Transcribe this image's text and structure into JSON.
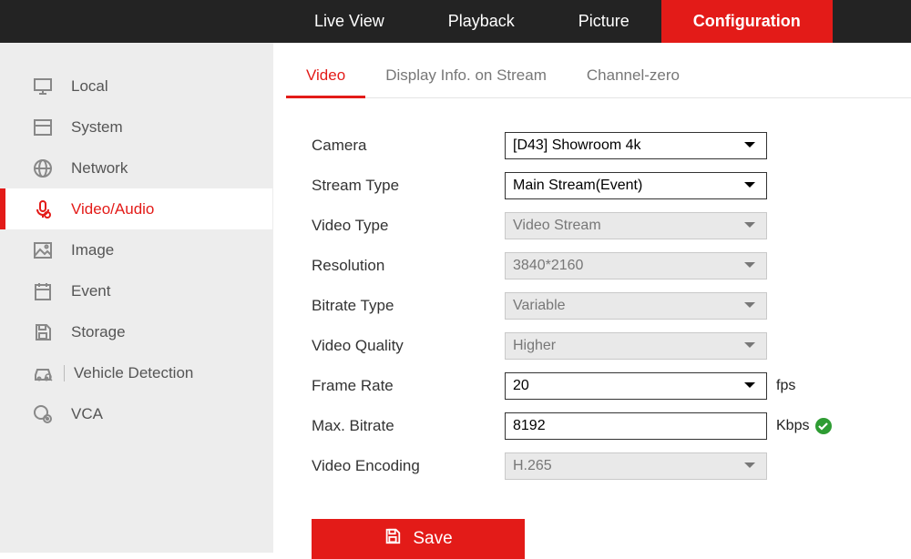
{
  "topnav": {
    "items": [
      "Live View",
      "Playback",
      "Picture",
      "Configuration"
    ],
    "active_index": 3
  },
  "sidebar": {
    "items": [
      {
        "label": "Local",
        "icon": "monitor"
      },
      {
        "label": "System",
        "icon": "window"
      },
      {
        "label": "Network",
        "icon": "globe"
      },
      {
        "label": "Video/Audio",
        "icon": "mic"
      },
      {
        "label": "Image",
        "icon": "image"
      },
      {
        "label": "Event",
        "icon": "calendar"
      },
      {
        "label": "Storage",
        "icon": "disk"
      },
      {
        "label": "Vehicle Detection",
        "icon": "car",
        "divider": true
      },
      {
        "label": "VCA",
        "icon": "vca"
      }
    ],
    "active_index": 3
  },
  "tabs": {
    "items": [
      "Video",
      "Display Info. on Stream",
      "Channel-zero"
    ],
    "active_index": 0
  },
  "form": {
    "camera": {
      "label": "Camera",
      "value": "[D43] Showroom 4k",
      "disabled": false
    },
    "stream_type": {
      "label": "Stream Type",
      "value": "Main Stream(Event)",
      "disabled": false
    },
    "video_type": {
      "label": "Video Type",
      "value": "Video Stream",
      "disabled": true
    },
    "resolution": {
      "label": "Resolution",
      "value": "3840*2160",
      "disabled": true
    },
    "bitrate_type": {
      "label": "Bitrate Type",
      "value": "Variable",
      "disabled": true
    },
    "video_quality": {
      "label": "Video Quality",
      "value": "Higher",
      "disabled": true
    },
    "frame_rate": {
      "label": "Frame Rate",
      "value": "20",
      "unit": "fps",
      "disabled": false
    },
    "max_bitrate": {
      "label": "Max. Bitrate",
      "value": "8192",
      "unit": "Kbps",
      "valid": true
    },
    "video_encoding": {
      "label": "Video Encoding",
      "value": "H.265",
      "disabled": true
    }
  },
  "buttons": {
    "save": "Save"
  }
}
